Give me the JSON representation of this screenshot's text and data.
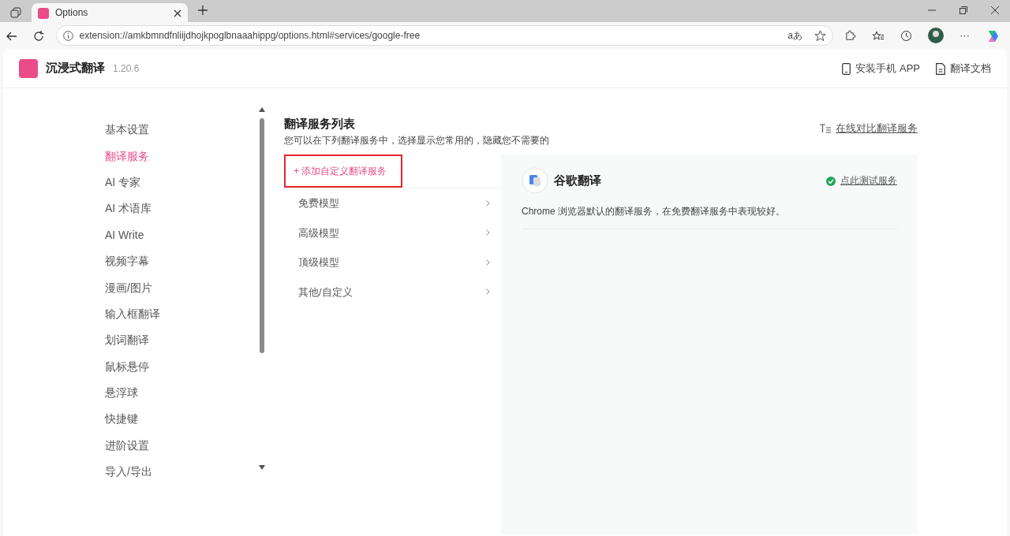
{
  "browser": {
    "tab_title": "Options",
    "address": "extension://amkbmndfnliijdhojkpoglbnaaahippg/options.html#services/google-free",
    "translate_glyph": "aあ",
    "more_glyph": "···"
  },
  "header": {
    "brand": "沉浸式翻译",
    "version": "1.20.6",
    "links": [
      {
        "label": "安装手机 APP",
        "kind": "phone"
      },
      {
        "label": "翻译文档",
        "kind": "doc"
      }
    ]
  },
  "sidebar": {
    "items": [
      {
        "label": "基本设置",
        "selected": false
      },
      {
        "label": "翻译服务",
        "selected": true
      },
      {
        "label": "AI 专家",
        "selected": false
      },
      {
        "label": "AI 术语库",
        "selected": false
      },
      {
        "label": "AI Write",
        "selected": false
      },
      {
        "label": "视频字幕",
        "selected": false
      },
      {
        "label": "漫画/图片",
        "selected": false
      },
      {
        "label": "输入框翻译",
        "selected": false
      },
      {
        "label": "划词翻译",
        "selected": false
      },
      {
        "label": "鼠标悬停",
        "selected": false
      },
      {
        "label": "悬浮球",
        "selected": false
      },
      {
        "label": "快捷键",
        "selected": false
      },
      {
        "label": "进阶设置",
        "selected": false
      },
      {
        "label": "导入/导出",
        "selected": false
      }
    ]
  },
  "main": {
    "title": "翻译服务列表",
    "subtitle": "您可以在下列翻译服务中，选择显示您常用的，隐藏您不需要的",
    "compare_link": "在线对比翻译服务",
    "add_button": {
      "label": "+ 添加自定义翻译服务",
      "highlighted": true
    },
    "groups": [
      {
        "label": "免费模型"
      },
      {
        "label": "高级模型"
      },
      {
        "label": "顶级模型"
      },
      {
        "label": "其他/自定义"
      }
    ],
    "detail": {
      "name": "谷歌翻译",
      "test_link": "点此测试服务",
      "description": "Chrome 浏览器默认的翻译服务，在免费翻译服务中表现较好。"
    }
  }
}
